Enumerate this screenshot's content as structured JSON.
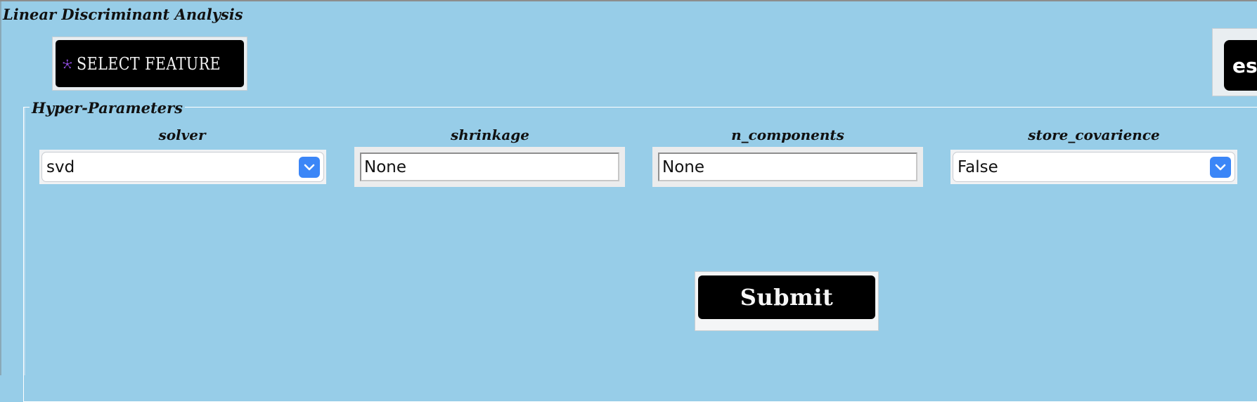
{
  "window": {
    "title": "Linear Discriminant Analysis"
  },
  "toolbar": {
    "select_feature_label": "SELECT FEATURE",
    "select_feature_icon": "network-nodes-icon",
    "right_button_partial_label": "es"
  },
  "hyper_parameters": {
    "group_title": "Hyper-Parameters",
    "solver": {
      "label": "solver",
      "value": "svd"
    },
    "shrinkage": {
      "label": "shrinkage",
      "value": "None"
    },
    "n_components": {
      "label": "n_components",
      "value": "None"
    },
    "store_covarience": {
      "label": "store_covarience",
      "value": "False"
    }
  },
  "actions": {
    "submit_label": "Submit"
  },
  "colors": {
    "background": "#97cde8",
    "button_black": "#000000",
    "select_arrow": "#3b86f7",
    "icon_purple": "#7a3fc0"
  }
}
